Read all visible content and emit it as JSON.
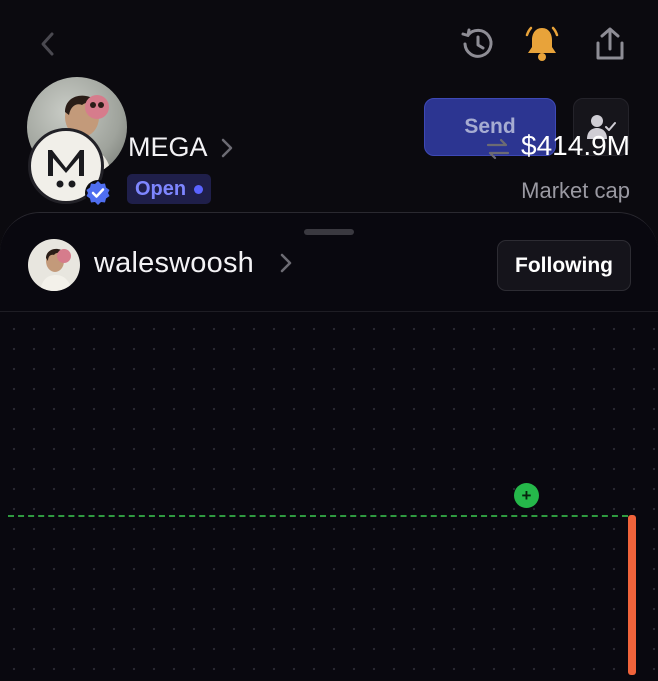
{
  "header": {
    "icons": [
      "back-chevron-icon",
      "history-icon",
      "bell-icon",
      "share-icon"
    ],
    "bell_color": "#e8a33a",
    "send_label": "Send"
  },
  "user": {
    "username": "waleswoosh",
    "following_label": "Following"
  },
  "token": {
    "logo_text": "M.",
    "name": "MEGA",
    "status": "Open",
    "market_value": "$414.9M",
    "market_label": "Market cap"
  },
  "chart": {
    "accent_up": "#25b84a",
    "accent_down": "#f0633b",
    "marker_label": "+"
  },
  "colors": {
    "background": "#0b0a0f",
    "send_button": "#2c3591",
    "status_text": "#7e86ff"
  }
}
